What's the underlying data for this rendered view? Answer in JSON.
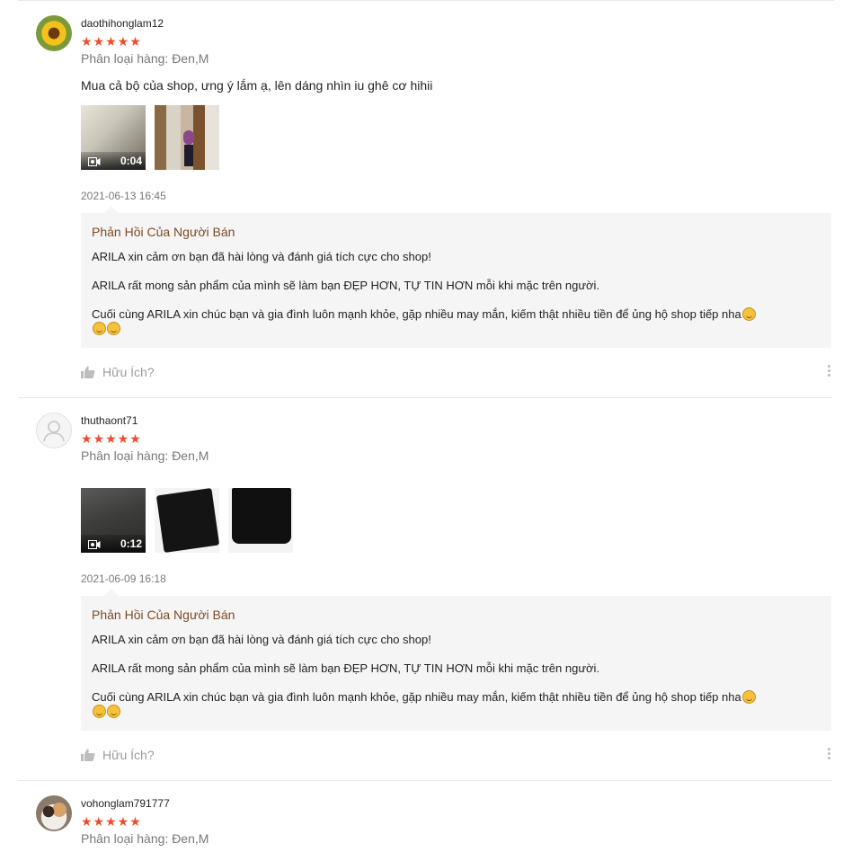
{
  "reviews": [
    {
      "username": "daothihonglam12",
      "stars": "★★★★★",
      "variation": "Phân loại hàng: Đen,M",
      "comment": "Mua cả bộ của shop, ưng ý lắm ạ, lên dáng nhìn iu ghê cơ hihii",
      "video_duration": "0:04",
      "time": "2021-06-13 16:45",
      "helpful_label": "Hữu Ích?"
    },
    {
      "username": "thuthaont71",
      "stars": "★★★★★",
      "variation": "Phân loại hàng: Đen,M",
      "comment": "",
      "video_duration": "0:12",
      "time": "2021-06-09 16:18",
      "helpful_label": "Hữu Ích?"
    },
    {
      "username": "vohonglam791777",
      "stars": "★★★★★",
      "variation": "Phân loại hàng: Đen,M"
    }
  ],
  "seller_reply": {
    "title": "Phản Hồi Của Người Bán",
    "line1": "ARILA xin cảm ơn bạn đã hài lòng và đánh giá tích cực cho shop!",
    "line2": "ARILA rất mong sản phẩm của mình sẽ làm bạn ĐẸP HƠN, TỰ TIN HƠN mỗi khi mặc trên người.",
    "line3": "Cuối cùng ARILA xin chúc bạn và gia đình luôn mạnh khỏe, gặp nhiều may mắn, kiếm thật nhiều tiền để ủng hộ shop tiếp nha"
  },
  "colors": {
    "star": "#ee4d2d",
    "reply_title": "#7d4a24",
    "reply_bg": "#f5f5f5"
  }
}
